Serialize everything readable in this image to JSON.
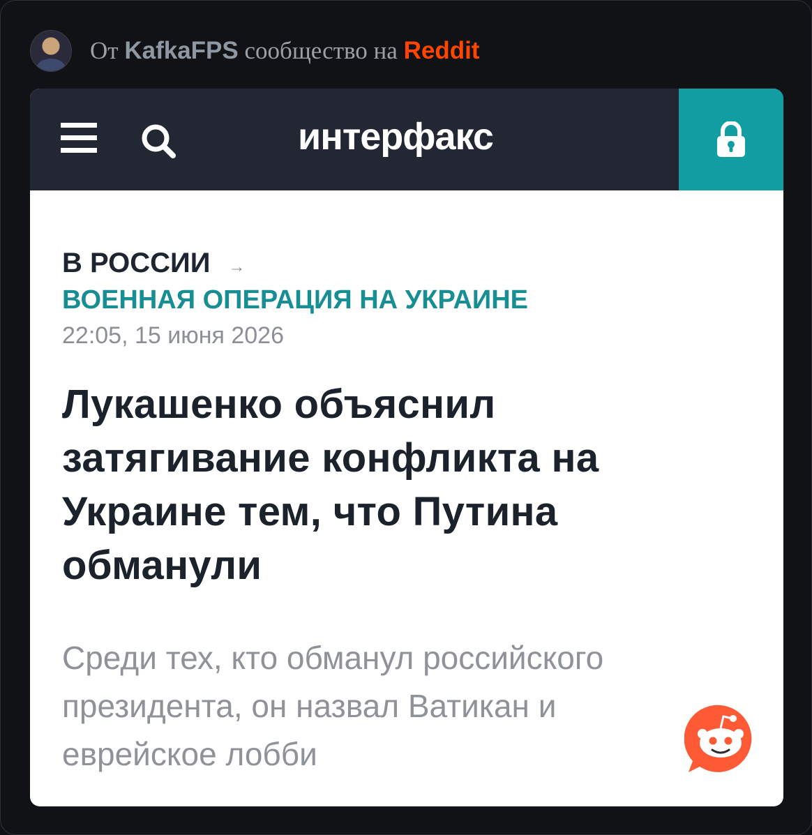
{
  "post_header": {
    "prefix": "От",
    "username": "KafkaFPS",
    "middle": "сообщество на",
    "platform": "Reddit"
  },
  "site": {
    "logo_text": "интерфакс",
    "accent_color": "#119ea3",
    "topbar_color": "#232733",
    "icons": [
      "menu-icon",
      "search-icon",
      "lock-icon"
    ]
  },
  "article": {
    "breadcrumb": "В РОССИИ",
    "breadcrumb_arrow": "→",
    "section": "ВОЕННАЯ ОПЕРАЦИЯ НА УКРАИНЕ",
    "datetime": "22:05, 15 июня 2026",
    "headline": "Лукашенко объяснил затягивание конфликта на Украине тем, что Путина обманули",
    "lead": "Среди тех, кто обманул российского президента, он назвал Ватикан и еврейское лобби"
  },
  "badge": {
    "icon": "reddit-snoo-icon",
    "color": "#ff5a36"
  }
}
